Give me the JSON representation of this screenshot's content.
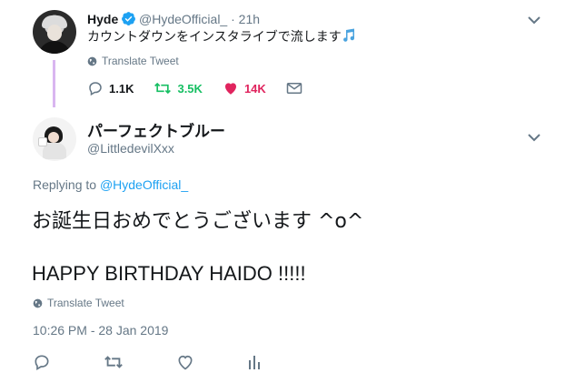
{
  "parent_tweet": {
    "display_name": "Hyde",
    "handle_time": "@HydeOfficial_ · 21h",
    "text": "カウントダウンをインスタライブで流します",
    "emoji_icon": "music-note-icon",
    "translate_label": "Translate Tweet",
    "reply_count": "1.1K",
    "retweet_count": "3.5K",
    "like_count": "14K"
  },
  "reply_tweet": {
    "display_name": "パーフェクトブルー",
    "handle": "@LittledevilXxx",
    "replying_prefix": "Replying to ",
    "replying_to": "@HydeOfficial_",
    "text_line1": "お誕生日おめでとうございます ^o^",
    "text_line2": "HAPPY BIRTHDAY HAIDO !!!!!",
    "translate_label": "Translate Tweet",
    "timestamp": "10:26 PM - 28 Jan 2019"
  },
  "colors": {
    "accent": "#1da1f2",
    "retweet": "#17bf63",
    "like": "#e0245e",
    "muted": "#657786",
    "thread_line": "#d9b6f0"
  }
}
